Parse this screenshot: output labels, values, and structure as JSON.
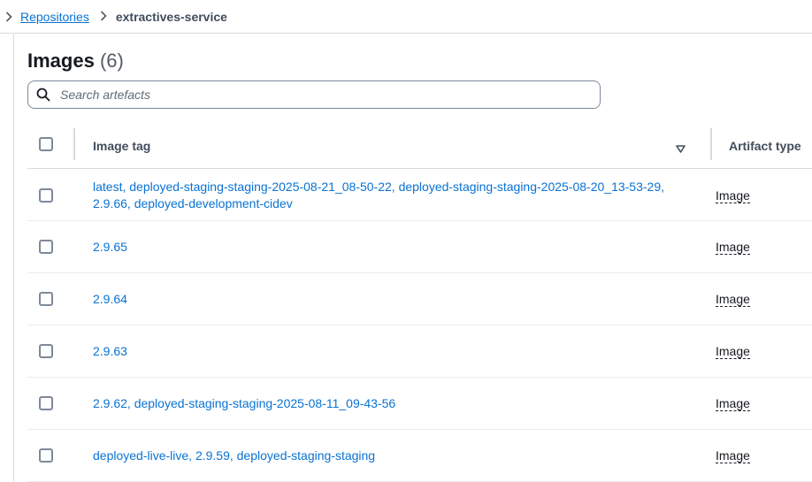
{
  "breadcrumb": {
    "parent": "Repositories",
    "current": "extractives-service"
  },
  "header": {
    "title": "Images",
    "count": "(6)"
  },
  "search": {
    "placeholder": "Search artefacts"
  },
  "table": {
    "columns": [
      "Image tag",
      "Artifact type"
    ],
    "rows": [
      {
        "tags_line1": "latest, deployed-staging-staging-2025-08-21_08-50-22, deployed-staging-staging-2025-08-20_13-53-29,",
        "tags_line2": "2.9.66, deployed-development-cidev",
        "type": "Image"
      },
      {
        "tags_line1": "2.9.65",
        "tags_line2": "",
        "type": "Image"
      },
      {
        "tags_line1": "2.9.64",
        "tags_line2": "",
        "type": "Image"
      },
      {
        "tags_line1": "2.9.63",
        "tags_line2": "",
        "type": "Image"
      },
      {
        "tags_line1": "2.9.62, deployed-staging-staging-2025-08-11_09-43-56",
        "tags_line2": "",
        "type": "Image"
      },
      {
        "tags_line1": "deployed-live-live, 2.9.59, deployed-staging-staging",
        "tags_line2": "",
        "type": "Image"
      }
    ]
  },
  "colors": {
    "link": "#0972d3",
    "text": "#16191f",
    "border": "#d5dbdb"
  }
}
